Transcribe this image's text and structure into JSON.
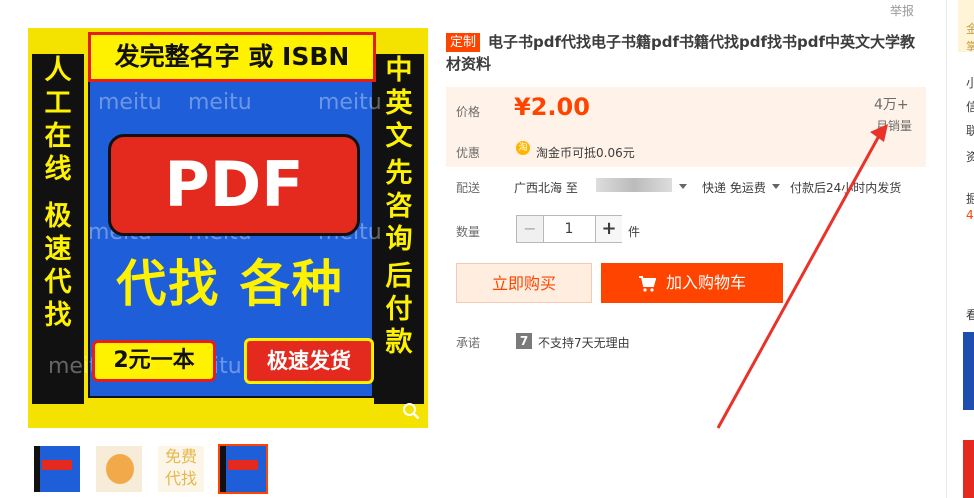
{
  "header": {
    "report": "举报"
  },
  "image": {
    "title_bar": "发完整名字 或 ISBN",
    "left_col": [
      "人",
      "工",
      "在",
      "线",
      "",
      "极",
      "速",
      "代",
      "找"
    ],
    "right_col": [
      "中",
      "英",
      "文",
      "",
      "先",
      "咨",
      "询",
      "",
      "后",
      "付",
      "款"
    ],
    "pdf": "PDF",
    "daizhao": "代找 各种",
    "badge_left": "2元一本",
    "badge_right": "极速发货",
    "watermark": "meitu",
    "thumb3_text": "免费代找"
  },
  "product": {
    "tag": "定制",
    "title": "电子书pdf代找电子书籍pdf书籍代找pdf找书pdf中英文大学教材资料"
  },
  "price": {
    "label": "价格",
    "value": "¥2.00",
    "sales_num": "4万+",
    "sales_label": "月销量"
  },
  "promo": {
    "label": "优惠",
    "coin": "淘",
    "text": "淘金币可抵0.06元"
  },
  "shipping": {
    "label": "配送",
    "from": "广西北海 至",
    "method": "快递 免运费",
    "time": "付款后24小时内发货"
  },
  "quantity": {
    "label": "数量",
    "value": "1",
    "minus": "−",
    "plus": "+",
    "unit": "件"
  },
  "actions": {
    "buy_now": "立即购买",
    "add_cart": "加入购物车"
  },
  "promise": {
    "label": "承诺",
    "icon": "7",
    "text": "不支持7天无理由"
  },
  "sidebar": {
    "chars": [
      "金",
      "掌",
      "小",
      "信",
      "联",
      "资",
      "掘",
      "4",
      "看"
    ]
  },
  "colors": {
    "accent": "#ff4400",
    "annotation_arrow": "#e8322a"
  }
}
